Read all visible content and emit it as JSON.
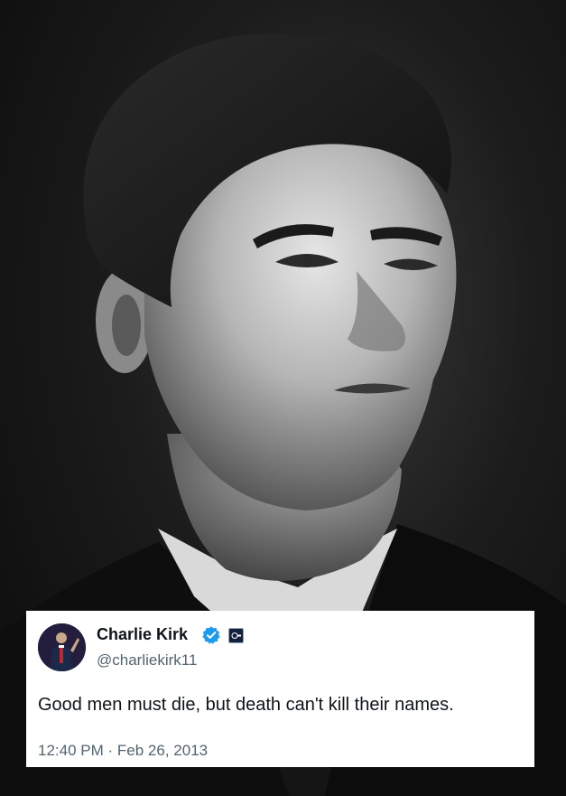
{
  "tweet": {
    "display_name": "Charlie Kirk",
    "handle": "@charliekirk11",
    "text": "Good men must die, but death can't kill their names.",
    "time": "12:40 PM",
    "separator": "·",
    "date": "Feb 26, 2013",
    "verified_icon": "verified-badge-icon",
    "affiliate_icon": "affiliate-badge-icon",
    "colors": {
      "name": "#0f1419",
      "secondary": "#536471",
      "verified": "#1d9bf0",
      "card_bg": "#ffffff"
    }
  },
  "photo": {
    "style": "black-and-white portrait"
  }
}
